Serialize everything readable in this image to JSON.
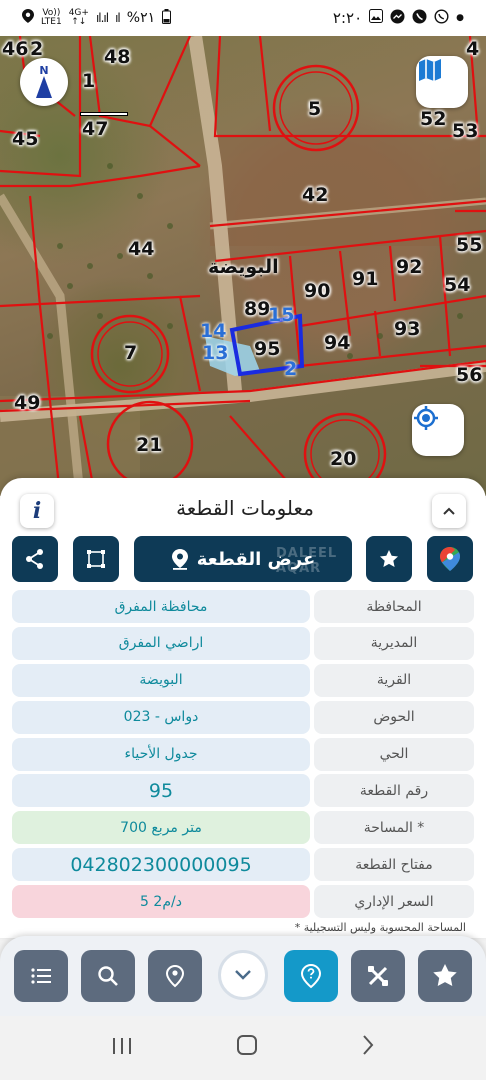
{
  "status_bar": {
    "time": "٢:٢٠",
    "battery": "%٢١",
    "network_top": "4G+",
    "network_bottom": "↑↓",
    "volte_top": "Vo))",
    "volte_bottom": "LTE1"
  },
  "map": {
    "village_label": "البويضة",
    "compass_letter": "N",
    "parcels": [
      "46",
      "2",
      "48",
      "1",
      "47",
      "45",
      "5",
      "52",
      "53",
      "4",
      "42",
      "44",
      "55",
      "91",
      "92",
      "90",
      "89",
      "54",
      "15",
      "14",
      "13",
      "95",
      "94",
      "93",
      "7",
      "2",
      "56",
      "49",
      "21",
      "20"
    ],
    "selected_parcel": "95",
    "selected_labels": [
      "15",
      "14",
      "13",
      "2"
    ]
  },
  "sheet": {
    "title": "معلومات القطعة",
    "info_label": "i",
    "show_parcel_label": "عرض القطعة",
    "watermark": "DALEEL AQAR",
    "rows": [
      {
        "key": "المحافظة",
        "value": "محافظة المفرق"
      },
      {
        "key": "المديرية",
        "value": "اراضي المفرق"
      },
      {
        "key": "القرية",
        "value": "البويضة"
      },
      {
        "key": "الحوض",
        "value": "دواس - 023"
      },
      {
        "key": "الحي",
        "value": "جدول الأحياء"
      },
      {
        "key": "رقم القطعة",
        "value": "95"
      },
      {
        "key": "المساحة *",
        "value": "700  متر مربع"
      },
      {
        "key": "مفتاح القطعة",
        "value": "042802300000095"
      },
      {
        "key": "السعر الإداري",
        "value": "5 د/م2"
      }
    ],
    "footnote": "* المساحة المحسوبة وليس التسجيلية"
  },
  "toolbar": {
    "items": [
      "list-icon",
      "search-icon",
      "location-pin-icon",
      "chevron-down-icon",
      "help-pin-icon",
      "tools-icon",
      "star-icon"
    ]
  },
  "colors": {
    "accent_dark": "#0e3a56",
    "toolbar_grey": "#5d6b7e",
    "active_blue": "#1499c9",
    "parcel_border": "#e01010",
    "selected_border": "#1a2be0"
  }
}
